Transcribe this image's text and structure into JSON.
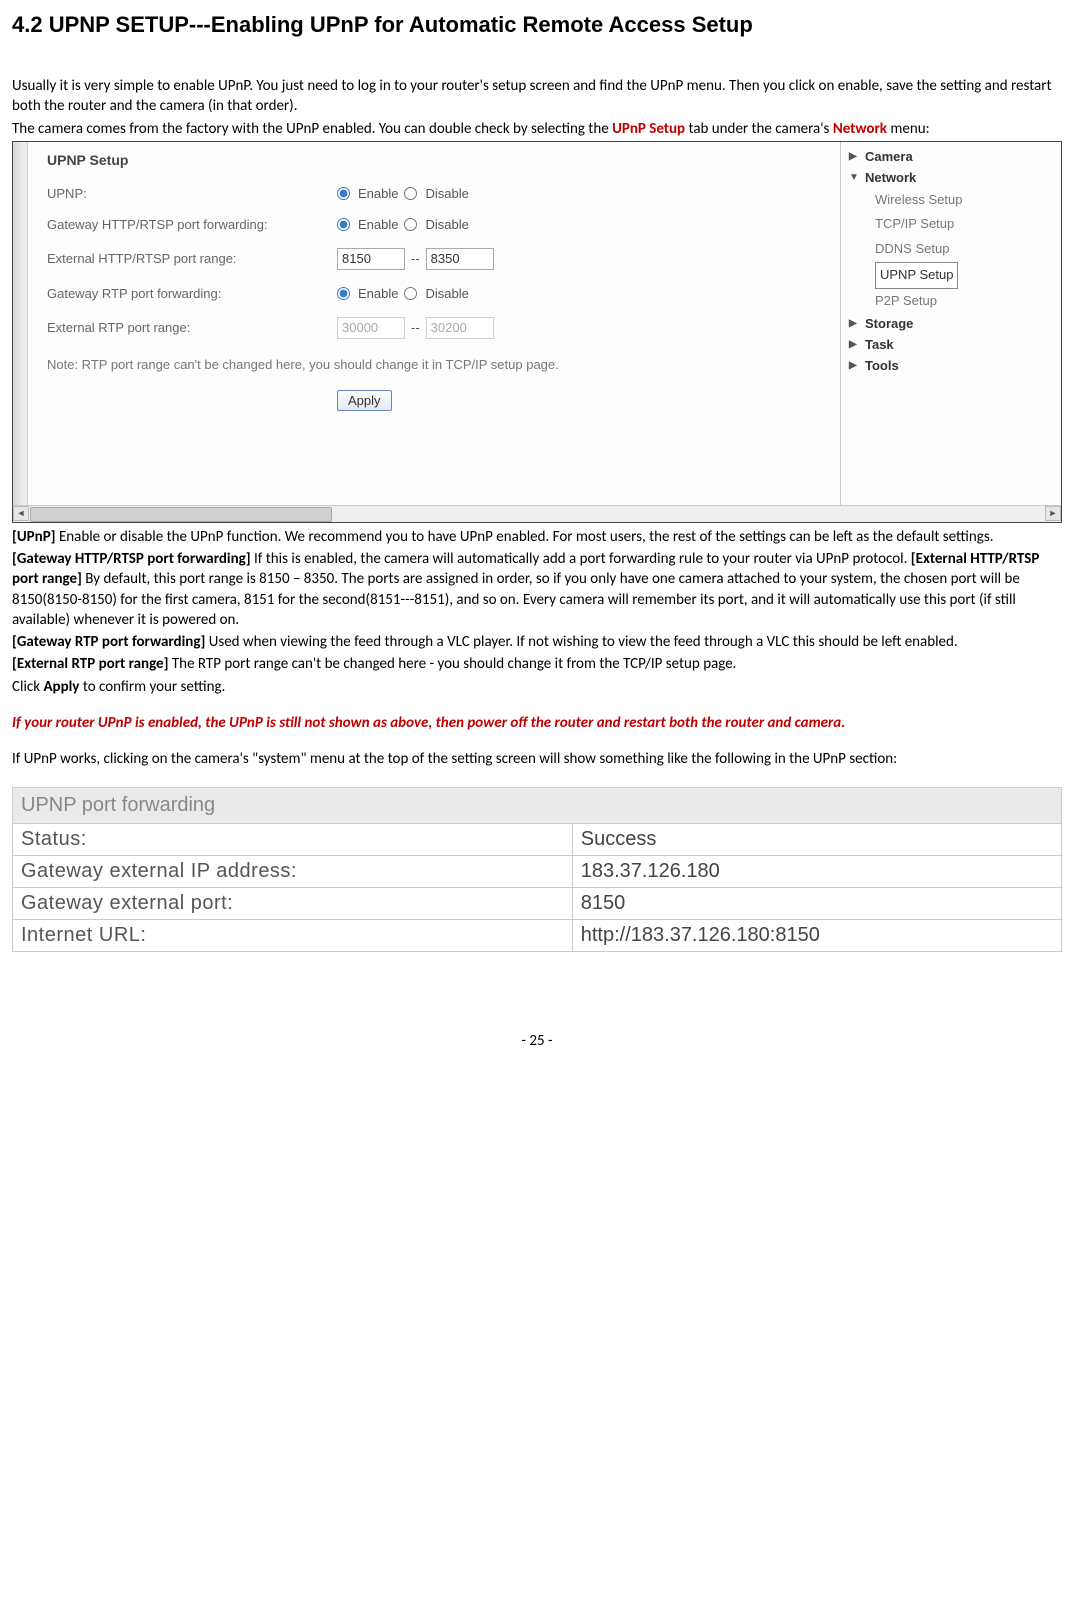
{
  "heading": "4.2 UPNP SETUP---Enabling UPnP for Automatic Remote Access Setup",
  "intro1": "Usually it is very simple to enable UPnP. You just need to log in to your router's setup screen and find the UPnP menu. Then you click on enable, save the setting and restart both the router and the camera (in that order).",
  "intro2a": "The camera comes from the factory with the UPnP enabled. You can double check by selecting the ",
  "intro2_upnp": "UPnP Setup",
  "intro2b": " tab under the camera's ",
  "intro2_net": "Network",
  "intro2c": " menu:",
  "s1": {
    "title": "UPNP Setup",
    "rows": {
      "upnp_label": "UPNP:",
      "gw_http_label": "Gateway HTTP/RTSP port forwarding:",
      "ext_http_label": "External HTTP/RTSP port range:",
      "gw_rtp_label": "Gateway RTP port forwarding:",
      "ext_rtp_label": "External RTP port range:"
    },
    "enable": "Enable",
    "disable": "Disable",
    "ext_http_a": "8150",
    "ext_http_b": "8350",
    "ext_rtp_a": "30000",
    "ext_rtp_b": "30200",
    "dashes": "--",
    "note": "Note: RTP port range can't be changed here, you should change it in TCP/IP setup page.",
    "apply": "Apply",
    "side": {
      "camera": "Camera",
      "network": "Network",
      "wireless": "Wireless Setup",
      "tcpip": "TCP/IP Setup",
      "ddns": "DDNS Setup",
      "upnp": "UPNP Setup",
      "p2p": "P2P Setup",
      "storage": "Storage",
      "task": "Task",
      "tools": "Tools"
    }
  },
  "desc": {
    "upnp_h": "[UPnP] ",
    "upnp_t": "Enable or disable the UPnP function. We recommend you to have UPnP enabled. For most users, the rest of the settings can be left as the default settings.",
    "gwhttp_h": "[Gateway HTTP/RTSP port forwarding] ",
    "gwhttp_t": "If this is enabled, the camera will automatically add a port forwarding rule to your router via UPnP protocol. ",
    "exthttp_h": "[External HTTP/RTSP port range] ",
    "exthttp_t": "By default, this port range is 8150 – 8350. The ports are assigned in order, so if you only have one camera attached to your system, the chosen port will be 8150(8150-8150) for the first camera, 8151 for the second(8151---8151), and so on. Every camera will remember its port, and it will automatically use this port (if still available) whenever it is powered on.",
    "gwrtp_h": "[Gateway RTP port forwarding] ",
    "gwrtp_t": "Used when viewing the feed through a VLC player. If not wishing to view the feed through a VLC this should be left enabled.",
    "extrtp_h": "[External RTP port range] ",
    "extrtp_t": "The RTP port range can't be changed here - you should change it from the TCP/IP setup page.",
    "click_a": "Click ",
    "click_b": "Apply",
    "click_c": " to confirm your setting."
  },
  "warn": "If your router UPnP is enabled, the UPnP is still not shown as above, then power off the router and restart both the router and camera.",
  "after": "If UPnP works, clicking on the camera's \"system\" menu at the top of the setting screen will show something like the following in the UPnP section:",
  "table": {
    "header": "UPNP port forwarding",
    "r1a": "Status:",
    "r1b": "Success",
    "r2a": "Gateway external IP address:",
    "r2b": "183.37.126.180",
    "r3a": "Gateway  external  port:",
    "r3b": "8150",
    "r4a": "Internet  URL:",
    "r4b": "http://183.37.126.180:8150"
  },
  "pagenum": "- 25 -"
}
